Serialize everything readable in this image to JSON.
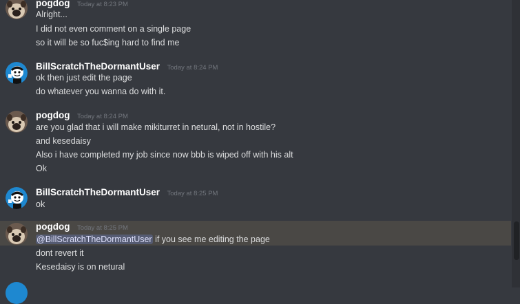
{
  "messages": [
    {
      "author": "pogdog",
      "timestamp": "Today at 8:23 PM",
      "lines": [
        "Alright...",
        "I did not even comment on a single page",
        "so it will be so fuc$ing hard to find me"
      ]
    },
    {
      "author": "BillScratchTheDormantUser",
      "timestamp": "Today at 8:24 PM",
      "lines": [
        "ok then just edit the page",
        "do whatever you wanna do with it."
      ]
    },
    {
      "author": "pogdog",
      "timestamp": "Today at 8:24 PM",
      "lines": [
        "are you glad that i will make mikiturret in netural, not in hostile?",
        "and kesedaisy",
        "Also i have completed my job since now bbb is wiped off with his alt",
        "Ok"
      ]
    },
    {
      "author": "BillScratchTheDormantUser",
      "timestamp": "Today at 8:25 PM",
      "lines": [
        "ok"
      ]
    },
    {
      "author": "pogdog",
      "timestamp": "Today at 8:25 PM",
      "mention": "@BillScratchTheDormantUser",
      "lines": [
        " if you see me editing the page",
        "dont revert it",
        "Kesedaisy is on netural"
      ]
    }
  ],
  "colors": {
    "background": "#36393f",
    "highlight": "#4a4845",
    "username": "#ffffff",
    "timestamp": "#72767d",
    "text": "#dcddde",
    "mention_bg": "#414775",
    "avatar_blue": "#1e88d0"
  },
  "icons": {
    "pogdog_avatar": "pug-photo-avatar",
    "bill_avatar": "cartoon-character-avatar"
  }
}
